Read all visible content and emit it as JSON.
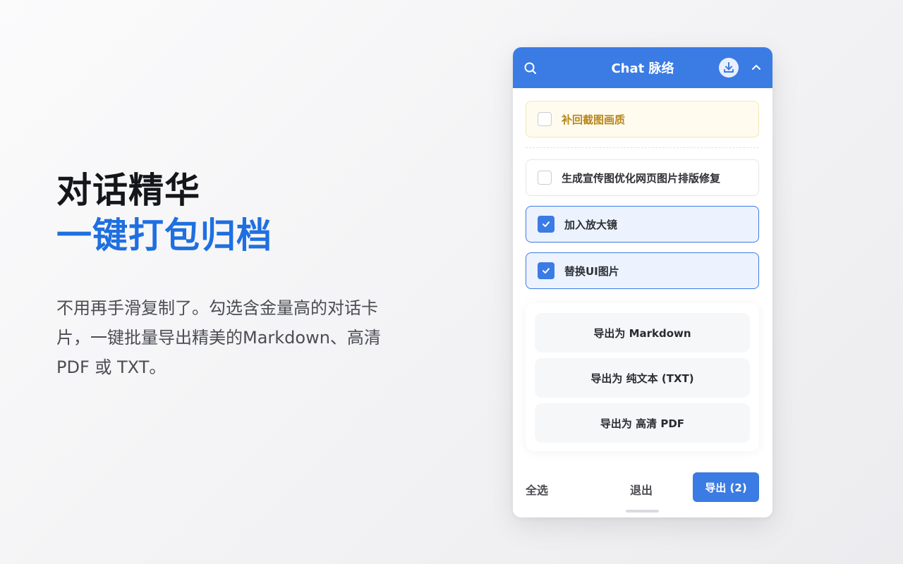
{
  "promo": {
    "title_line1": "对话精华",
    "title_line2": "一键打包归档",
    "description": "不用再手滑复制了。勾选含金量高的对话卡片，一键批量导出精美的Markdown、高清 PDF 或 TXT。"
  },
  "panel": {
    "header": {
      "title": "Chat 脉络",
      "icons": [
        "search-icon",
        "download-icon",
        "chevron-up-icon"
      ],
      "color": "#3b7be4"
    },
    "warning_item": {
      "label": "补回截图画质",
      "checked": false
    },
    "items": [
      {
        "label": "生成宣传图优化网页图片排版修复",
        "checked": false
      },
      {
        "label": "加入放大镜",
        "checked": true
      },
      {
        "label": "替换UI图片",
        "checked": true
      }
    ],
    "export_options": [
      "导出为 Markdown",
      "导出为 纯文本 (TXT)",
      "导出为 高清 PDF"
    ],
    "footer": {
      "select_all": "全选",
      "exit": "退出",
      "export": "导出 (2)"
    }
  },
  "colors": {
    "accent": "#3b7be4",
    "highlight": "#1f6fe0",
    "warning": "#b8861a"
  }
}
